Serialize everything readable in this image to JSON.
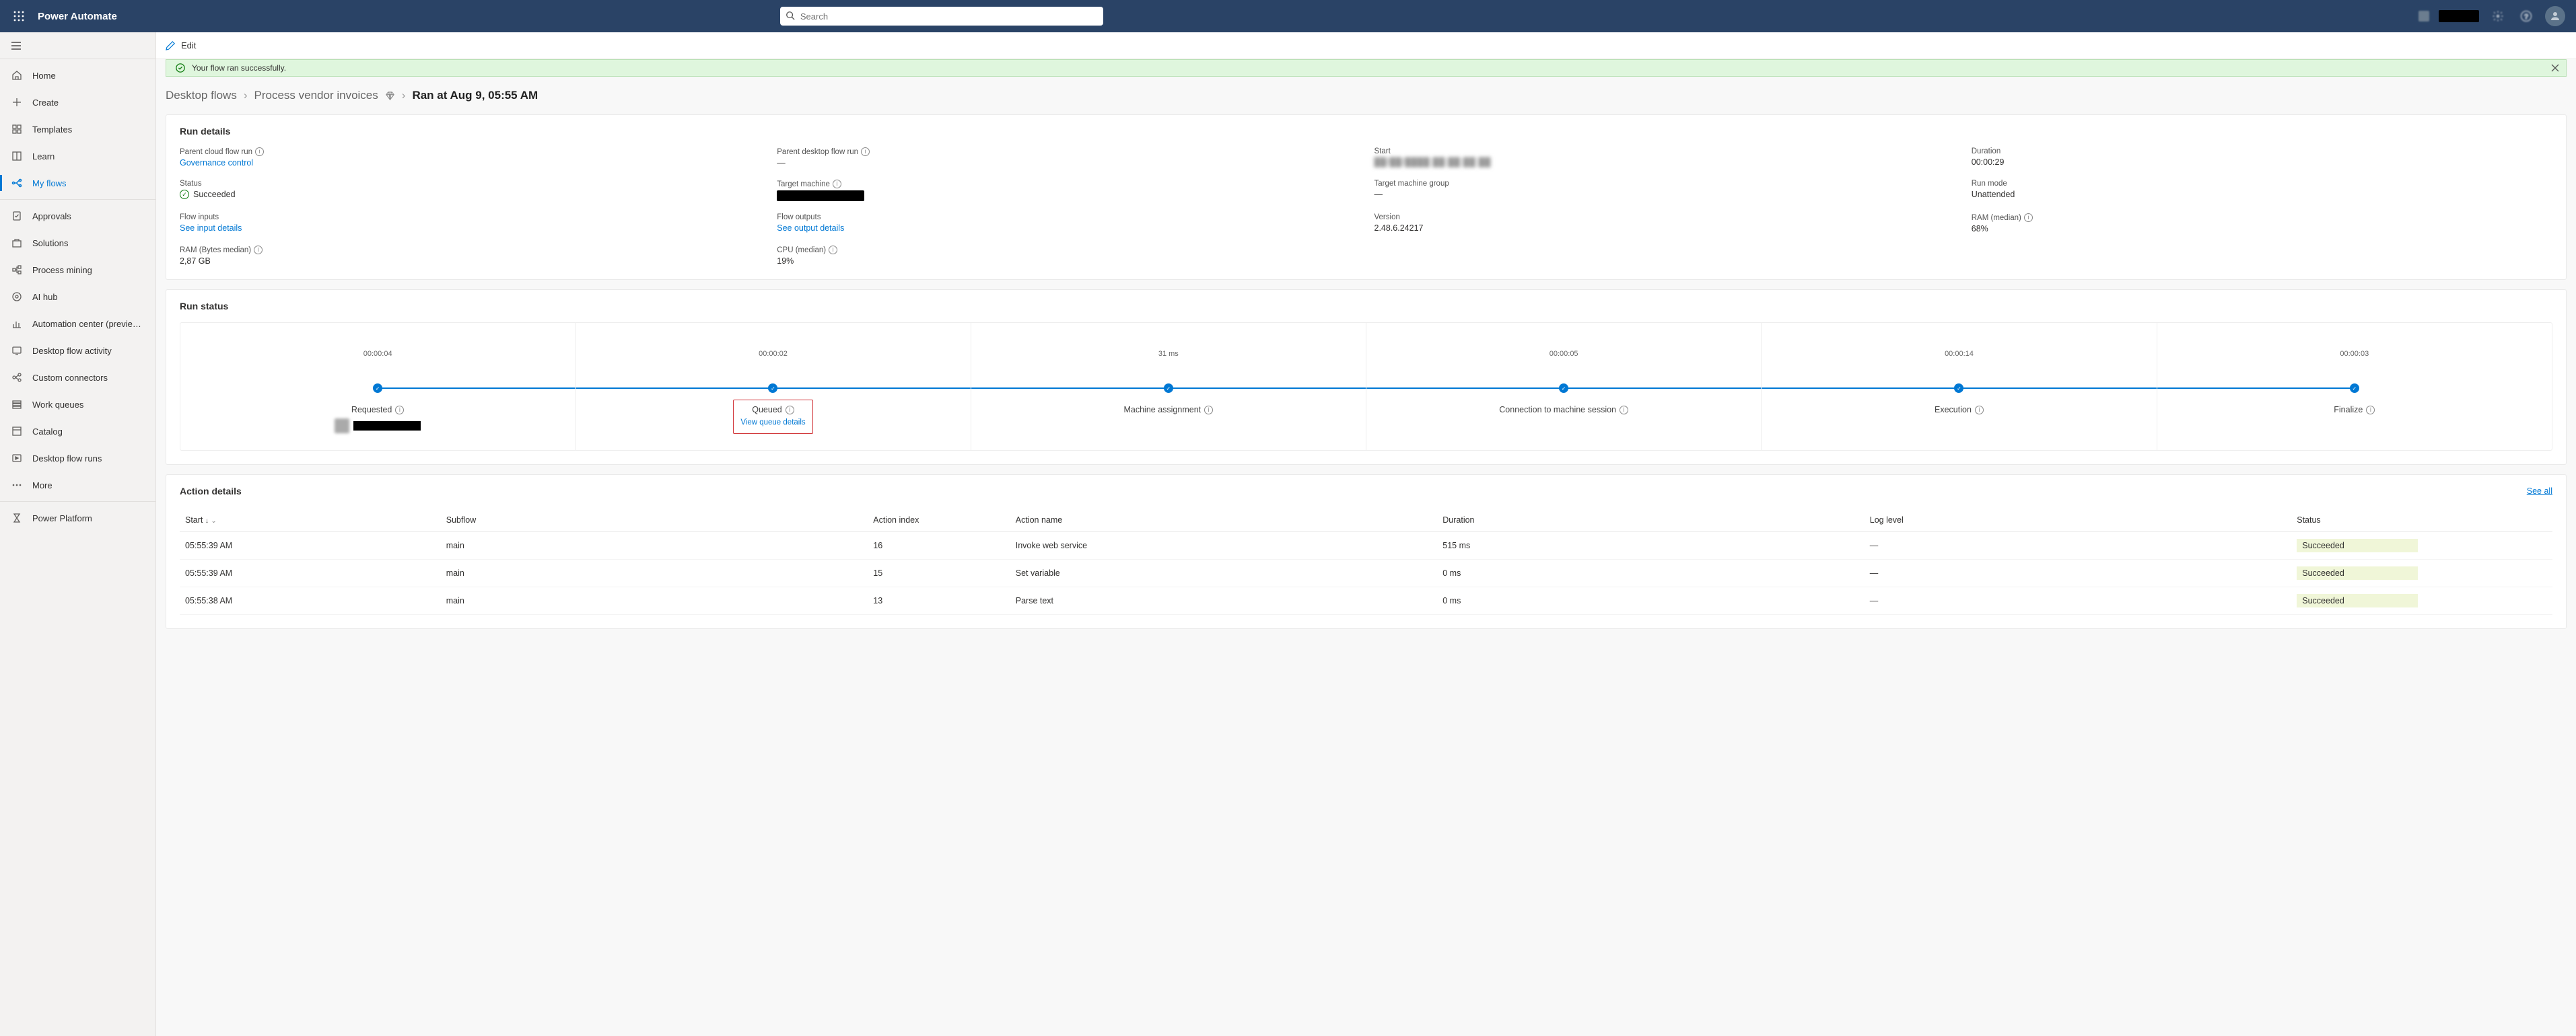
{
  "header": {
    "app_name": "Power Automate",
    "search_placeholder": "Search"
  },
  "sidebar": {
    "items": [
      {
        "label": "Home",
        "icon": "home"
      },
      {
        "label": "Create",
        "icon": "plus"
      },
      {
        "label": "Templates",
        "icon": "templates"
      },
      {
        "label": "Learn",
        "icon": "book"
      },
      {
        "label": "My flows",
        "icon": "flow",
        "active": true
      },
      {
        "label": "Approvals",
        "icon": "approvals"
      },
      {
        "label": "Solutions",
        "icon": "solutions"
      },
      {
        "label": "Process mining",
        "icon": "process"
      },
      {
        "label": "AI hub",
        "icon": "ai"
      },
      {
        "label": "Automation center (previe…",
        "icon": "chart"
      },
      {
        "label": "Desktop flow activity",
        "icon": "activity"
      },
      {
        "label": "Custom connectors",
        "icon": "connectors"
      },
      {
        "label": "Work queues",
        "icon": "queues"
      },
      {
        "label": "Catalog",
        "icon": "catalog"
      },
      {
        "label": "Desktop flow runs",
        "icon": "runs"
      },
      {
        "label": "More",
        "icon": "more"
      },
      {
        "label": "Power Platform",
        "icon": "platform"
      }
    ]
  },
  "edit_bar": {
    "label": "Edit"
  },
  "banner": {
    "text": "Your flow ran successfully."
  },
  "breadcrumb": {
    "level1": "Desktop flows",
    "level2": "Process vendor invoices",
    "current": "Ran at Aug 9, 05:55 AM"
  },
  "run_details": {
    "title": "Run details",
    "rows": [
      [
        {
          "label": "Parent cloud flow run",
          "info": true,
          "value_link": "Governance control"
        },
        {
          "label": "Parent desktop flow run",
          "info": true,
          "value": "—"
        },
        {
          "label": "Start",
          "blurred": true
        },
        {
          "label": "Duration",
          "value": "00:00:29"
        }
      ],
      [
        {
          "label": "Status",
          "status_success": "Succeeded"
        },
        {
          "label": "Target machine",
          "info": true,
          "redacted": true
        },
        {
          "label": "Target machine group",
          "value": "—"
        },
        {
          "label": "Run mode",
          "value": "Unattended"
        }
      ],
      [
        {
          "label": "Flow inputs",
          "value_link": "See input details"
        },
        {
          "label": "Flow outputs",
          "value_link": "See output details"
        },
        {
          "label": "Version",
          "value": "2.48.6.24217"
        },
        {
          "label": "RAM (median)",
          "info": true,
          "value": "68%"
        }
      ],
      [
        {
          "label": "RAM (Bytes median)",
          "info": true,
          "value": "2,87 GB"
        },
        {
          "label": "CPU (median)",
          "info": true,
          "value": "19%"
        }
      ]
    ]
  },
  "run_status": {
    "title": "Run status",
    "stages": [
      {
        "time": "00:00:04",
        "label": "Requested",
        "user": true
      },
      {
        "time": "00:00:02",
        "label": "Queued",
        "link": "View queue details",
        "highlight": true
      },
      {
        "time": "31 ms",
        "label": "Machine assignment"
      },
      {
        "time": "00:00:05",
        "label": "Connection to machine session"
      },
      {
        "time": "00:00:14",
        "label": "Execution"
      },
      {
        "time": "00:00:03",
        "label": "Finalize"
      }
    ]
  },
  "action_details": {
    "title": "Action details",
    "see_all": "See all",
    "columns": {
      "start": "Start",
      "subflow": "Subflow",
      "index": "Action index",
      "name": "Action name",
      "duration": "Duration",
      "log": "Log level",
      "status": "Status"
    },
    "rows": [
      {
        "start": "05:55:39 AM",
        "subflow": "main",
        "index": "16",
        "name": "Invoke web service",
        "duration": "515 ms",
        "log": "—",
        "status": "Succeeded"
      },
      {
        "start": "05:55:39 AM",
        "subflow": "main",
        "index": "15",
        "name": "Set variable",
        "duration": "0 ms",
        "log": "—",
        "status": "Succeeded"
      },
      {
        "start": "05:55:38 AM",
        "subflow": "main",
        "index": "13",
        "name": "Parse text",
        "duration": "0 ms",
        "log": "—",
        "status": "Succeeded"
      }
    ]
  }
}
